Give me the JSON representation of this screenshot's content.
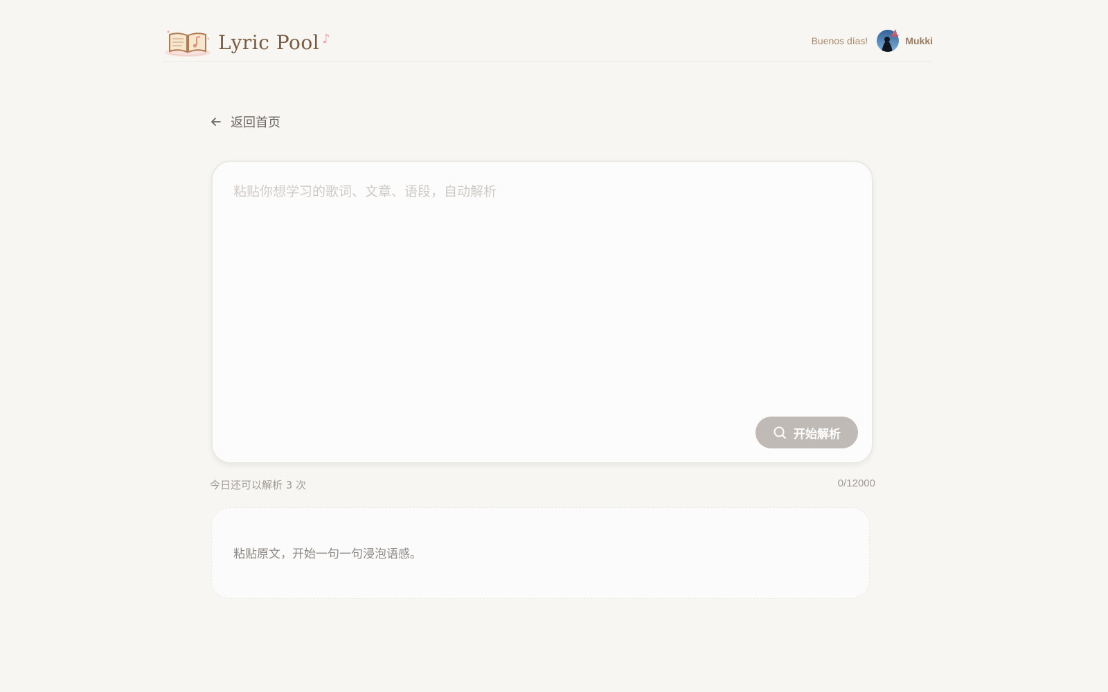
{
  "header": {
    "logo_text": "Lyric Pool",
    "logo_note": "♪",
    "greeting": "Buenos días!",
    "username": "Mukki"
  },
  "nav": {
    "back_label": "返回首页"
  },
  "editor": {
    "placeholder": "粘贴你想学习的歌词、文章、语段，自动解析",
    "value": "",
    "analyze_label": "开始解析"
  },
  "meta": {
    "quota_text": "今日还可以解析 3 次",
    "char_count": "0/12000"
  },
  "hint": {
    "text": "粘贴原文，开始一句一句浸泡语感。"
  },
  "colors": {
    "background": "#f7f6f2",
    "brand_text": "#7a5a3f",
    "button_disabled": "#bfbab6",
    "card": "#fdfcfc"
  },
  "icons": {
    "logo": "open-book-music-icon",
    "back": "arrow-left-icon",
    "analyze": "search-icon",
    "avatar": "witch-hat-avatar"
  }
}
